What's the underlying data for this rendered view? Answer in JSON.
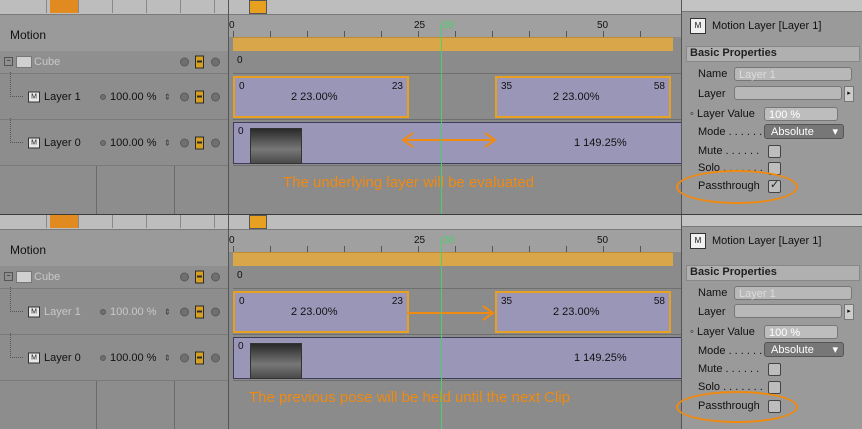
{
  "top": {
    "motion_header": "Motion",
    "rows": [
      {
        "name": "Cube",
        "pct": ""
      },
      {
        "name": "Layer 1",
        "pct": "100.00 %"
      },
      {
        "name": "Layer 0",
        "pct": "100.00 %"
      }
    ],
    "ruler": {
      "t0": "0",
      "t25": "25",
      "t50": "50",
      "cur": "28"
    },
    "cube_track_label": "0",
    "layer1_clips": [
      {
        "start": "0",
        "end": "23",
        "mid": "2  23.00%"
      },
      {
        "start": "35",
        "end": "58",
        "mid": "2  23.00%"
      }
    ],
    "layer0_clip": {
      "start": "0",
      "mid": "1  149.25%"
    },
    "message": "The underlying layer will be evaluated",
    "attr": {
      "title": "Motion Layer [Layer 1]",
      "section": "Basic Properties",
      "name_label": "Name",
      "name_value": "Layer 1",
      "layer_label": "Layer",
      "layer_value_label": "Layer Value",
      "layer_value": "100 %",
      "mode_label": "Mode . . . . . .",
      "mode_value": "Absolute",
      "mute_label": "Mute . . . . . .",
      "solo_label": "Solo . . . . . . .",
      "passthrough_label": "Passthrough",
      "passthrough_checked": true
    }
  },
  "bottom": {
    "motion_header": "Motion",
    "rows": [
      {
        "name": "Cube",
        "pct": ""
      },
      {
        "name": "Layer 1",
        "pct": "100.00 %"
      },
      {
        "name": "Layer 0",
        "pct": "100.00 %"
      }
    ],
    "ruler": {
      "t0": "0",
      "t25": "25",
      "t50": "50",
      "cur": "28"
    },
    "cube_track_label": "0",
    "layer1_clips": [
      {
        "start": "0",
        "end": "23",
        "mid": "2  23.00%"
      },
      {
        "start": "35",
        "end": "58",
        "mid": "2  23.00%"
      }
    ],
    "layer0_clip": {
      "start": "0",
      "mid": "1  149.25%"
    },
    "message": "The previous pose will be held until the next Clip",
    "attr": {
      "title": "Motion Layer [Layer 1]",
      "section": "Basic Properties",
      "name_label": "Name",
      "name_value": "Layer 1",
      "layer_label": "Layer",
      "layer_value_label": "Layer Value",
      "layer_value": "100 %",
      "mode_label": "Mode . . . . . .",
      "mode_value": "Absolute",
      "mute_label": "Mute . . . . . .",
      "solo_label": "Solo . . . . . . .",
      "passthrough_label": "Passthrough",
      "passthrough_checked": false
    }
  },
  "colors": {
    "accent": "#f08a10",
    "clip": "#9a96b8",
    "playhead": "#4ad06a",
    "gold_track": "#d9a74a"
  }
}
